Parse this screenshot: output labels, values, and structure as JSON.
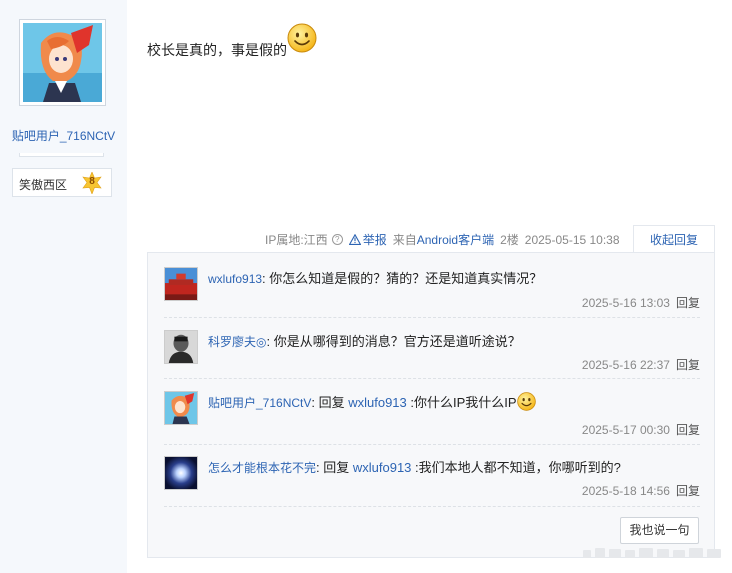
{
  "author": {
    "username": "贴吧用户_716NCtV",
    "level_name": "笑傲西区",
    "level_number": "8"
  },
  "post": {
    "content": "校长是真的，事是假的",
    "emoji": "smile-emoji",
    "ip_location": "IP属地:江西",
    "report_label": "举报",
    "source_prefix": "来自",
    "client": "Android客户端",
    "floor": "2楼",
    "datetime": "2025-05-15 10:38",
    "collapse_label": "收起回复"
  },
  "replies": [
    {
      "username": "wxlufo913",
      "text": ": 你怎么知道是假的？猜的？还是知道真实情况？",
      "time": "2025-5-16 13:03",
      "reply_label": "回复"
    },
    {
      "username": "科罗廖夫",
      "badge": "◎",
      "text": ": 你是从哪得到的消息？官方还是道听途说？",
      "time": "2025-5-16 22:37",
      "reply_label": "回复"
    },
    {
      "username": "贴吧用户_716NCtV",
      "prefix": ": 回复 ",
      "quoted": "wxlufo913",
      "text": " :你什么IP我什么IP",
      "time": "2025-5-17 00:30",
      "reply_label": "回复"
    },
    {
      "username": "怎么才能根本花不完",
      "prefix": ": 回复 ",
      "quoted": "wxlufo913",
      "text": " :我们本地人都不知道，你哪听到的?",
      "time": "2025-5-18 14:56",
      "reply_label": "回复"
    }
  ],
  "say_button": "我也说一句",
  "colors": {
    "link": "#2d64b3",
    "sidebar_bg": "#f5f8fc",
    "reply_bg": "#f7f8fa",
    "meta_gray": "#888888"
  }
}
